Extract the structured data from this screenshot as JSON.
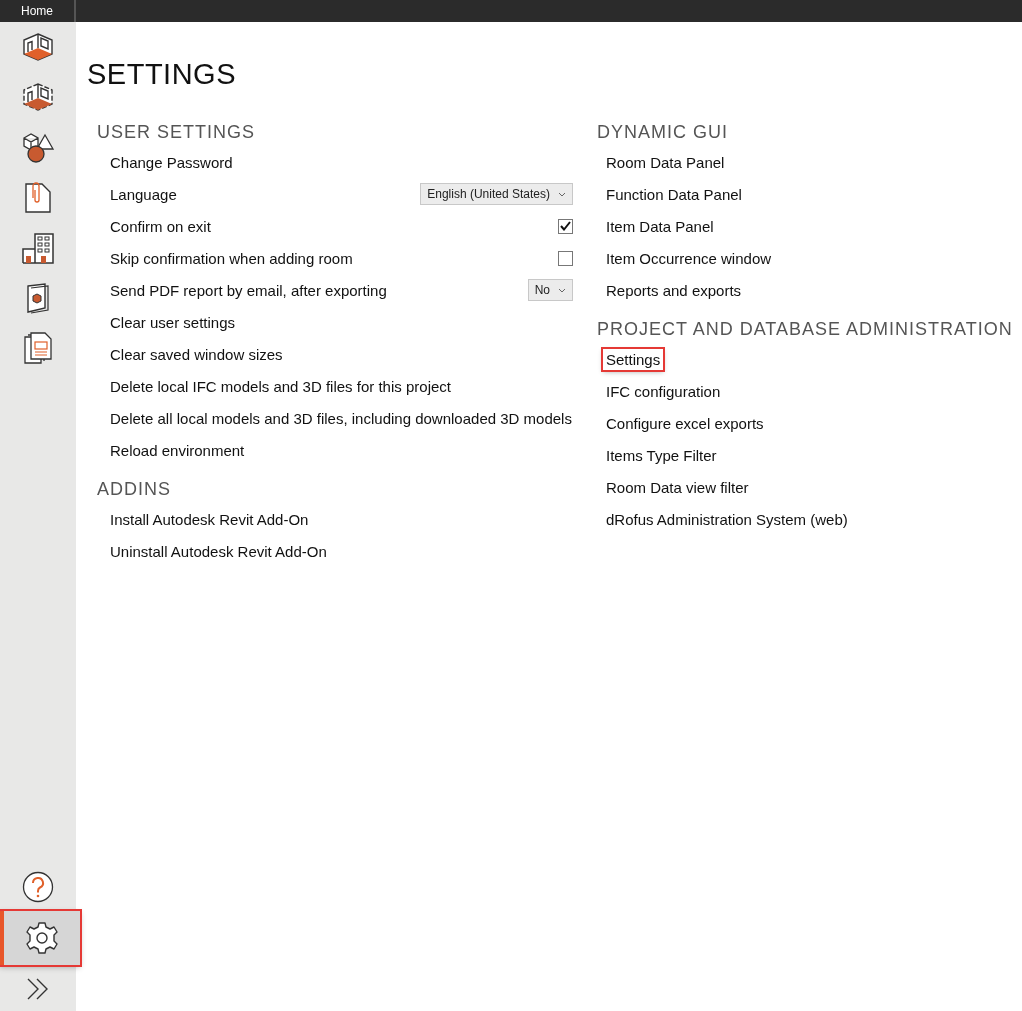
{
  "top_bar": {
    "tab": "Home"
  },
  "sidebar": {
    "items": [
      {
        "kind": "room",
        "selected": false,
        "highlighted": false
      },
      {
        "kind": "room-dashed",
        "selected": false,
        "highlighted": false
      },
      {
        "kind": "shapes",
        "selected": false,
        "highlighted": false
      },
      {
        "kind": "attachment",
        "selected": false,
        "highlighted": false
      },
      {
        "kind": "building",
        "selected": false,
        "highlighted": false
      },
      {
        "kind": "catalog",
        "selected": false,
        "highlighted": false
      },
      {
        "kind": "reports",
        "selected": false,
        "highlighted": false
      }
    ],
    "bottom_items": [
      {
        "kind": "help",
        "selected": false,
        "highlighted": false
      },
      {
        "kind": "settings",
        "selected": true,
        "highlighted": true
      },
      {
        "kind": "expand",
        "selected": false,
        "highlighted": false
      }
    ]
  },
  "page": {
    "title": "SETTINGS"
  },
  "columns": [
    {
      "sections": [
        {
          "heading": "USER SETTINGS",
          "items": [
            {
              "kind": "link",
              "label": "Change Password",
              "highlighted": false
            },
            {
              "kind": "dropdown",
              "label": "Language",
              "value": "English (United States)",
              "highlighted": false
            },
            {
              "kind": "checkbox",
              "label": "Confirm on exit",
              "checked": true,
              "highlighted": false
            },
            {
              "kind": "checkbox",
              "label": "Skip confirmation when adding room",
              "checked": false,
              "highlighted": false
            },
            {
              "kind": "dropdown",
              "label": "Send PDF report by email, after exporting",
              "value": "No",
              "highlighted": false
            },
            {
              "kind": "link",
              "label": "Clear user settings",
              "highlighted": false
            },
            {
              "kind": "link",
              "label": "Clear saved window sizes",
              "highlighted": false
            },
            {
              "kind": "link",
              "label": "Delete local IFC models and 3D files for this project",
              "highlighted": false
            },
            {
              "kind": "link",
              "label": "Delete all local models and 3D files, including downloaded 3D models",
              "highlighted": false
            },
            {
              "kind": "link",
              "label": "Reload environment",
              "highlighted": false
            }
          ]
        },
        {
          "heading": "ADDINS",
          "items": [
            {
              "kind": "link",
              "label": "Install Autodesk Revit Add-On",
              "highlighted": false
            },
            {
              "kind": "link",
              "label": "Uninstall Autodesk Revit Add-On",
              "highlighted": false
            }
          ]
        }
      ]
    },
    {
      "sections": [
        {
          "heading": "DYNAMIC GUI",
          "items": [
            {
              "kind": "link",
              "label": "Room Data Panel",
              "highlighted": false
            },
            {
              "kind": "link",
              "label": "Function Data Panel",
              "highlighted": false
            },
            {
              "kind": "link",
              "label": "Item Data Panel",
              "highlighted": false
            },
            {
              "kind": "link",
              "label": "Item Occurrence window",
              "highlighted": false
            },
            {
              "kind": "link",
              "label": "Reports and exports",
              "highlighted": false
            }
          ]
        },
        {
          "heading": "PROJECT AND DATABASE ADMINISTRATION",
          "items": [
            {
              "kind": "link",
              "label": "Settings",
              "highlighted": true
            },
            {
              "kind": "link",
              "label": "IFC configuration",
              "highlighted": false
            },
            {
              "kind": "link",
              "label": "Configure excel exports",
              "highlighted": false
            },
            {
              "kind": "link",
              "label": "Items Type Filter",
              "highlighted": false
            },
            {
              "kind": "link",
              "label": "Room Data view filter",
              "highlighted": false
            },
            {
              "kind": "link",
              "label": "dRofus Administration System (web)",
              "highlighted": false
            }
          ]
        }
      ]
    }
  ]
}
